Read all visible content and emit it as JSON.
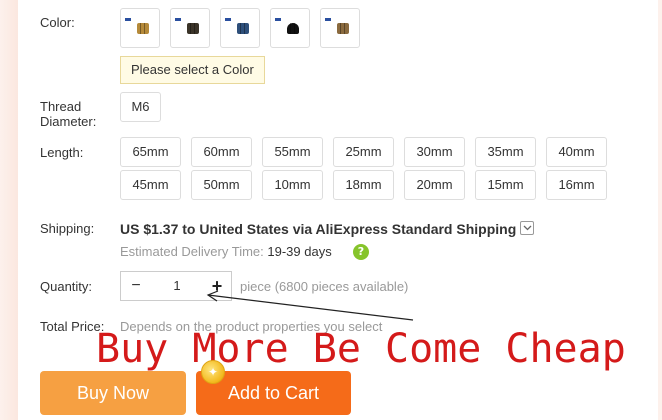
{
  "color": {
    "label": "Color:",
    "swatches": [
      {
        "name": "gold",
        "color": "#b58a3a"
      },
      {
        "name": "black-gold",
        "color": "#3a3328"
      },
      {
        "name": "blue",
        "color": "#2e4f7a"
      },
      {
        "name": "black",
        "color": "#111111"
      },
      {
        "name": "bronze",
        "color": "#8a6a3e"
      }
    ],
    "warning": "Please select a Color"
  },
  "thread": {
    "label_line1": "Thread",
    "label_line2": "Diameter:",
    "options": [
      "M6"
    ]
  },
  "length": {
    "label": "Length:",
    "row1": [
      "65mm",
      "60mm",
      "55mm",
      "25mm",
      "30mm",
      "35mm",
      "40mm"
    ],
    "row2": [
      "45mm",
      "50mm",
      "10mm",
      "18mm",
      "20mm",
      "15mm",
      "16mm"
    ]
  },
  "shipping": {
    "label": "Shipping:",
    "main": "US $1.37 to United States via AliExpress Standard Shipping",
    "eta_label": "Estimated Delivery Time:",
    "eta_days": "19-39 days",
    "help": "?"
  },
  "quantity": {
    "label": "Quantity:",
    "minus": "−",
    "value": "1",
    "plus": "+",
    "available": "piece (6800 pieces available)"
  },
  "total": {
    "label": "Total Price:",
    "note": "Depends on the product properties you select"
  },
  "promo": "Buy More Be Come Cheap",
  "buttons": {
    "buy_now": "Buy Now",
    "add_to_cart": "Add to Cart"
  },
  "colors": {
    "buy_now": "#f6a042",
    "add_to_cart": "#f56b19",
    "promo": "#d41a1a",
    "help": "#86c42b"
  }
}
